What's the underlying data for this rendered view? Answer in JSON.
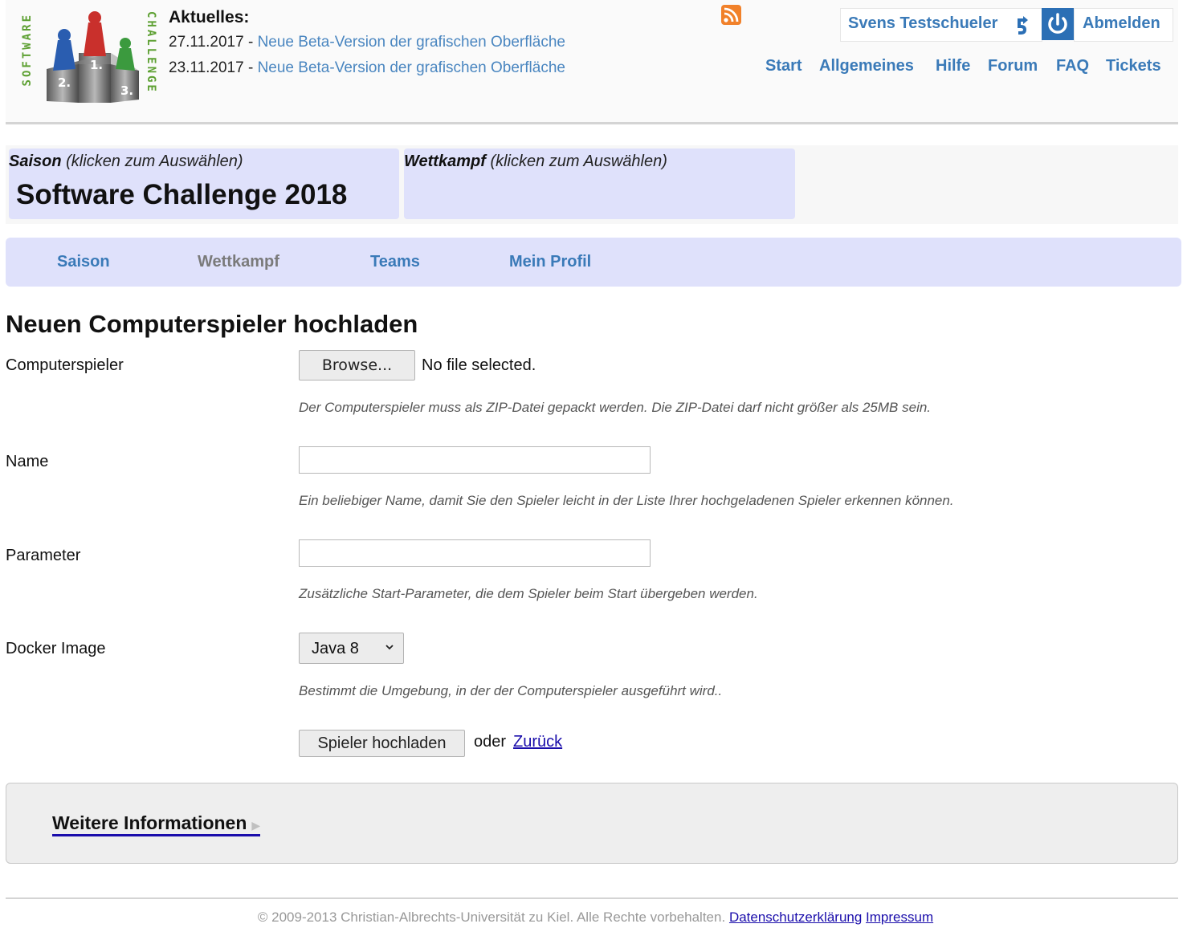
{
  "header": {
    "logo": {
      "left_text": "SOFTWARE",
      "right_text": "CHALLENGE",
      "places": [
        "1.",
        "2.",
        "3."
      ]
    },
    "news": {
      "heading": "Aktuelles:",
      "items": [
        {
          "date": "27.11.2017",
          "separator": " - ",
          "link": "Neue Beta-Version der grafischen Oberfläche"
        },
        {
          "date": "23.11.2017",
          "separator": " - ",
          "link": "Neue Beta-Version der grafischen Oberfläche"
        }
      ]
    },
    "rss_icon": "rss-feed-icon",
    "user_name": "Svens Testschueler",
    "logout": "Abmelden",
    "nav": [
      "Start",
      "Allgemeines",
      "Hilfe",
      "Forum",
      "FAQ",
      "Tickets"
    ]
  },
  "selectors": {
    "season": {
      "label": "Saison",
      "hint": "(klicken zum Auswählen)",
      "value": "Software Challenge 2018"
    },
    "contest": {
      "label": "Wettkampf",
      "hint": "(klicken zum Auswählen)",
      "value": ""
    }
  },
  "tabs": [
    {
      "label": "Saison",
      "active": true
    },
    {
      "label": "Wettkampf",
      "active": false
    },
    {
      "label": "Teams",
      "active": true
    },
    {
      "label": "Mein Profil",
      "active": true
    }
  ],
  "form": {
    "title": "Neuen Computerspieler hochladen",
    "file_label": "Computerspieler",
    "browse_label": "Browse...",
    "no_file": "No file selected.",
    "file_hint": "Der Computerspieler muss als ZIP-Datei gepackt werden. Die ZIP-Datei darf nicht größer als 25MB sein.",
    "name_label": "Name",
    "name_value": "",
    "name_hint": "Ein beliebiger Name, damit Sie den Spieler leicht in der Liste Ihrer hochgeladenen Spieler erkennen können.",
    "param_label": "Parameter",
    "param_value": "",
    "param_hint": "Zusätzliche Start-Parameter, die dem Spieler beim Start übergeben werden.",
    "docker_label": "Docker Image",
    "docker_value": "Java 8",
    "docker_hint": "Bestimmt die Umgebung, in der der Computerspieler ausgeführt wird..",
    "submit_label": "Spieler hochladen",
    "or_text": "oder",
    "back_link": "Zurück"
  },
  "info": {
    "label": "Weitere Informationen",
    "arrow": "▶"
  },
  "footer": {
    "copyright": "© 2009-2013 Christian-Albrechts-Universität zu Kiel. Alle Rechte vorbehalten.",
    "privacy": "Datenschutzerklärung",
    "imprint": "Impressum"
  },
  "colors": {
    "link_blue": "#3a7ab8",
    "tab_bg": "#dfe1fb",
    "tab_inactive": "#7a7a7a",
    "logo_green": "#5da032"
  }
}
